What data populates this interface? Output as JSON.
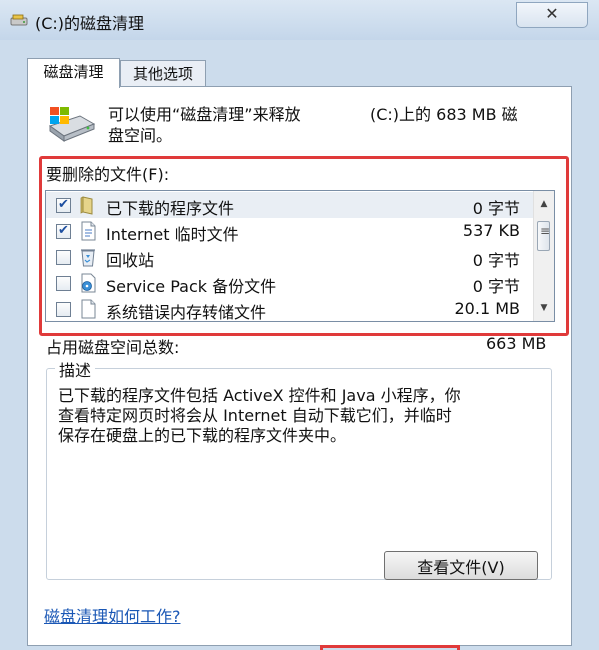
{
  "window": {
    "title": "(C:)的磁盘清理",
    "close_glyph": "✕"
  },
  "tabs": [
    {
      "label": "磁盘清理",
      "active": true
    },
    {
      "label": "其他选项",
      "active": false
    }
  ],
  "summary": {
    "line1_left": "可以使用“磁盘清理”来释放",
    "line1_right": "(C:)上的 683 MB 磁",
    "line2": "盘空间。"
  },
  "files_list": {
    "label": "要删除的文件(F):",
    "rows": [
      {
        "checked": true,
        "icon": "folder-icon",
        "name": "已下载的程序文件",
        "size": "0 字节",
        "selected": true
      },
      {
        "checked": true,
        "icon": "page-icon",
        "name": "Internet 临时文件",
        "size": "537 KB",
        "selected": false
      },
      {
        "checked": false,
        "icon": "recycle-bin-icon",
        "name": "回收站",
        "size": "0 字节",
        "selected": false
      },
      {
        "checked": false,
        "icon": "disk-backup-icon",
        "name": "Service Pack 备份文件",
        "size": "0 字节",
        "selected": false
      },
      {
        "checked": false,
        "icon": "blank-file-icon",
        "name": "系统错误内存转储文件",
        "size": "20.1 MB",
        "selected": false
      }
    ],
    "scroll_up_glyph": "▲",
    "scroll_down_glyph": "▼",
    "thumb_grip_glyph": "≡"
  },
  "total": {
    "label": "占用磁盘空间总数:",
    "value": "663 MB"
  },
  "description": {
    "title": "描述",
    "lines": [
      "已下载的程序文件包括 ActiveX 控件和 Java 小程序，你",
      "查看特定网页时将会从 Internet 自动下载它们，并临时",
      "保存在硬盘上的已下载的程序文件夹中。"
    ],
    "view_button": "查看文件(V)"
  },
  "help_link": "磁盘清理如何工作?",
  "colors": {
    "highlight_frame": "#e03a3a",
    "link": "#1a57b5",
    "window_frame": "#ccdcec"
  }
}
